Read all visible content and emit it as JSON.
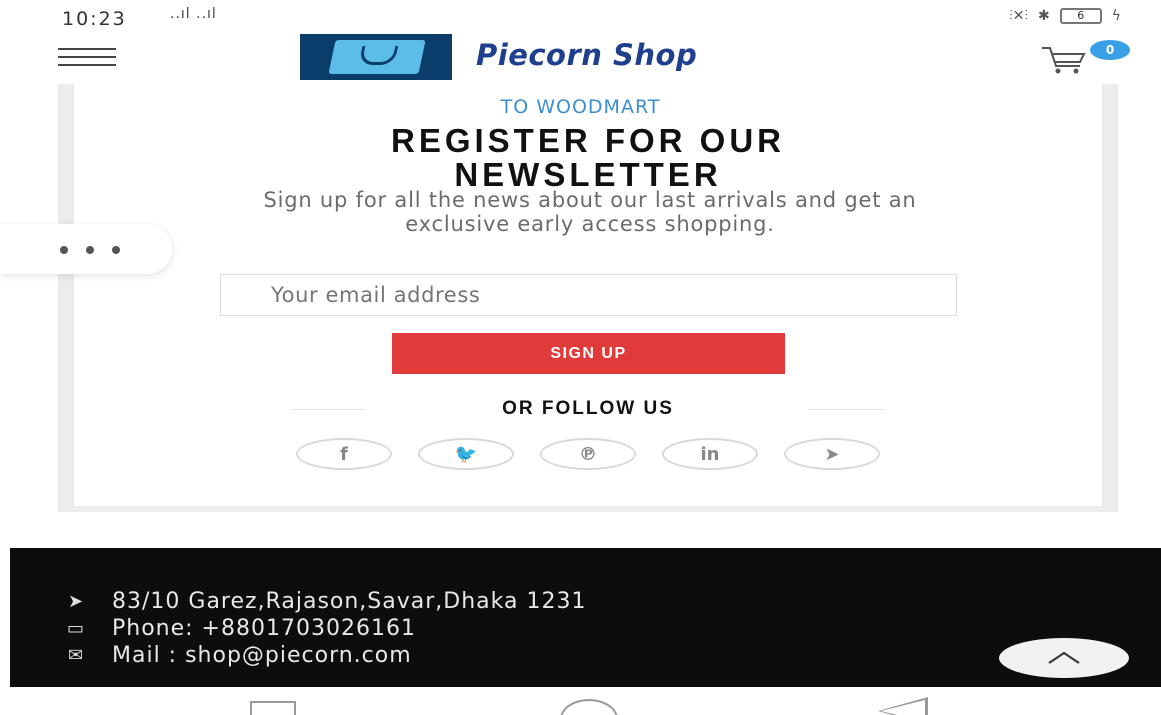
{
  "status_bar": {
    "time": "10:23",
    "signal": "..ıl ..ıl",
    "battery": "6"
  },
  "header": {
    "brand": "Piecorn Shop",
    "cart_count": "0"
  },
  "newsletter": {
    "kicker": "TO WOODMART",
    "title_line1": "REGISTER FOR OUR",
    "title_line2": "NEWSLETTER",
    "description": "Sign up for all the news about our last arrivals and get an exclusive early access shopping.",
    "email_placeholder": "Your email address",
    "signup_label": "SIGN UP",
    "follow_label": "OR FOLLOW US",
    "socials": [
      {
        "label": "f",
        "icon": "facebook-icon"
      },
      {
        "label": "🐦",
        "icon": "twitter-icon"
      },
      {
        "label": "℗",
        "icon": "pinterest-icon"
      },
      {
        "label": "in",
        "icon": "linkedin-icon"
      },
      {
        "label": "➤",
        "icon": "telegram-icon"
      }
    ]
  },
  "footer": {
    "address": "83/10 Garez,Rajason,Savar,Dhaka 1231",
    "phone": "Phone: +8801703026161",
    "mail": "Mail : shop@piecorn.com"
  },
  "colors": {
    "accent_red": "#e03a3a",
    "brand_blue": "#1f3f8f",
    "kicker_blue": "#3b8fd1",
    "footer_bg": "#0d0d0d"
  }
}
